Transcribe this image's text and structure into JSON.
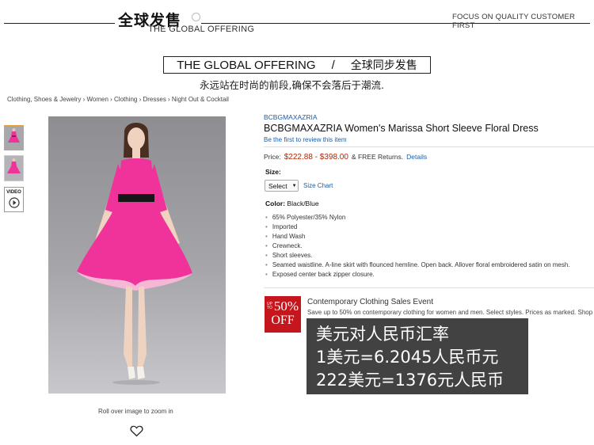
{
  "header": {
    "title_cn": "全球发售",
    "title_en": "THE GLOBAL OFFERING",
    "focus": "FOCUS ON QUALITY CUSTOMER FIRST"
  },
  "banner": {
    "en": "THE GLOBAL OFFERING",
    "sep": "/",
    "cn": "全球同步发售",
    "tagline": "永远站在时尚的前段,确保不会落后于潮流."
  },
  "breadcrumb": "Clothing, Shoes & Jewelry › Women › Clothing › Dresses › Night Out & Cocktail",
  "gallery": {
    "video_label": "VIDEO",
    "zoom_hint": "Roll over image to zoom in"
  },
  "product": {
    "brand": "BCBGMAXAZRIA",
    "title": "BCBGMAXAZRIA Women's Marissa Short Sleeve Floral Dress",
    "review_link": "Be the first to review this item",
    "price_label": "Price:",
    "price_range": "$222.88 - $398.00",
    "shipping": "& FREE Returns.",
    "details_link": "Details",
    "size_label": "Size:",
    "size_select": "Select",
    "size_chart": "Size Chart",
    "color_label": "Color:",
    "color_value": "Black/Blue",
    "features": [
      "65% Polyester/35% Nylon",
      "Imported",
      "Hand Wash",
      "Crewneck.",
      "Short sleeves.",
      "Seamed waistline. A-line skirt with flounced hemline. Open back. Allover floral embroidered satin on mesh.",
      "Exposed center back zipper closure."
    ]
  },
  "promo": {
    "badge_top": "UP TO",
    "badge_pct": "50%",
    "badge_off": "OFF",
    "title": "Contemporary Clothing Sales Event",
    "desc": "Save up to 50% on contemporary clothing for women and men. Select styles. Prices as marked. Shop"
  },
  "exchange": {
    "line1": "美元对人民币汇率",
    "line2": "1美元=6.2045人民币元",
    "line3": "222美元=1376元人民币"
  },
  "colors": {
    "dress": "#f0339a",
    "link": "#1a5ea8",
    "price": "#b12704",
    "sale": "#c4161c"
  }
}
